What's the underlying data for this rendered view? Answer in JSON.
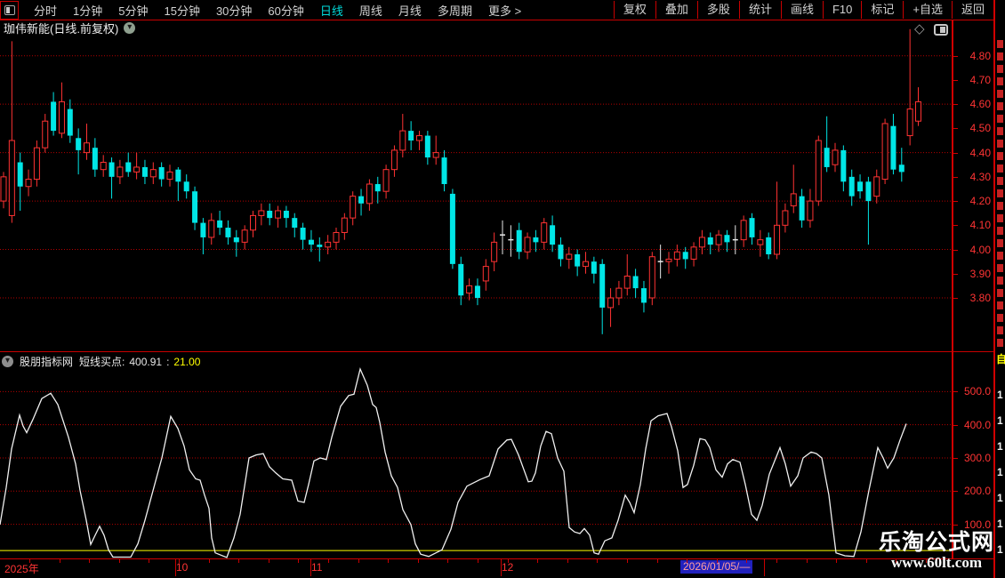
{
  "colors": {
    "up": "#ff3232",
    "down": "#00e6e6",
    "doji": "#e8e8e8",
    "grid": "#b40000",
    "axis_text": "#ff3434",
    "yellow_line": "#ffff00",
    "active_tab": "#00dcdc",
    "highlight_bg": "#2121bd"
  },
  "toolbar": {
    "left_items": [
      {
        "label": "分时",
        "active": false
      },
      {
        "label": "1分钟",
        "active": false
      },
      {
        "label": "5分钟",
        "active": false
      },
      {
        "label": "15分钟",
        "active": false
      },
      {
        "label": "30分钟",
        "active": false
      },
      {
        "label": "60分钟",
        "active": false
      },
      {
        "label": "日线",
        "active": true
      },
      {
        "label": "周线",
        "active": false
      },
      {
        "label": "月线",
        "active": false
      },
      {
        "label": "多周期",
        "active": false
      },
      {
        "label": "更多 >",
        "active": false
      }
    ],
    "right_items": [
      "复权",
      "叠加",
      "多股",
      "统计",
      "画线",
      "F10",
      "标记",
      "+自选",
      "返回"
    ]
  },
  "chart_header": {
    "title": "珈伟新能(日线.前复权)"
  },
  "main_chart": {
    "y_labels": [
      "4.80",
      "4.70",
      "4.60",
      "4.50",
      "4.40",
      "4.30",
      "4.20",
      "4.10",
      "4.00",
      "3.90",
      "3.80"
    ],
    "grid_prices": [
      4.8,
      4.6,
      4.4,
      4.2,
      4.0,
      3.8
    ]
  },
  "indicator": {
    "source": "股朋指标网",
    "name": "短线买点:",
    "value": "400.91",
    "sep": ":",
    "value2": "21.00",
    "y_labels": [
      "500.0",
      "400.0",
      "300.0",
      "200.0",
      "100.0"
    ]
  },
  "date_axis": {
    "labels": [
      {
        "text": "2025年",
        "x": 5
      },
      {
        "text": "10",
        "x": 198
      },
      {
        "text": "11",
        "x": 350
      },
      {
        "text": "12",
        "x": 564
      }
    ],
    "selected": {
      "text": "2026/01/05/—",
      "x": 765
    },
    "tall_ticks": [
      197,
      349,
      563,
      859
    ]
  },
  "watermark": {
    "line1": "乐淘公式网",
    "line2": "www.60lt.com"
  },
  "right_edge_panel": {
    "tab": "自",
    "numbers": [
      "1",
      "1",
      "1",
      "1",
      "1",
      "1",
      "1"
    ]
  },
  "chart_data": [
    {
      "type": "candlestick",
      "title": "珈伟新能 日线 前复权",
      "ylim": [
        3.6,
        4.95
      ],
      "y_ticks": [
        3.8,
        3.9,
        4.0,
        4.1,
        4.2,
        4.3,
        4.4,
        4.5,
        4.6,
        4.7,
        4.8
      ],
      "note": "o,h,l,c per day; close==open rendered as white doji cross",
      "candles": [
        [
          4.2,
          4.32,
          4.17,
          4.3
        ],
        [
          4.14,
          4.86,
          4.11,
          4.45
        ],
        [
          4.36,
          4.4,
          4.16,
          4.26
        ],
        [
          4.26,
          4.33,
          4.22,
          4.29
        ],
        [
          4.29,
          4.45,
          4.26,
          4.42
        ],
        [
          4.42,
          4.56,
          4.4,
          4.53
        ],
        [
          4.61,
          4.65,
          4.47,
          4.49
        ],
        [
          4.48,
          4.69,
          4.46,
          4.61
        ],
        [
          4.58,
          4.62,
          4.44,
          4.47
        ],
        [
          4.46,
          4.5,
          4.31,
          4.41
        ],
        [
          4.4,
          4.52,
          4.37,
          4.44
        ],
        [
          4.42,
          4.46,
          4.3,
          4.33
        ],
        [
          4.33,
          4.39,
          4.3,
          4.36
        ],
        [
          4.36,
          4.38,
          4.21,
          4.3
        ],
        [
          4.3,
          4.37,
          4.27,
          4.34
        ],
        [
          4.36,
          4.4,
          4.3,
          4.32
        ],
        [
          4.32,
          4.4,
          4.29,
          4.34
        ],
        [
          4.34,
          4.37,
          4.27,
          4.3
        ],
        [
          4.3,
          4.36,
          4.27,
          4.33
        ],
        [
          4.34,
          4.36,
          4.26,
          4.29
        ],
        [
          4.29,
          4.35,
          4.26,
          4.32
        ],
        [
          4.33,
          4.34,
          4.2,
          4.28
        ],
        [
          4.28,
          4.31,
          4.21,
          4.24
        ],
        [
          4.24,
          4.26,
          4.08,
          4.11
        ],
        [
          4.11,
          4.13,
          3.98,
          4.05
        ],
        [
          4.05,
          4.15,
          4.02,
          4.12
        ],
        [
          4.12,
          4.16,
          4.06,
          4.09
        ],
        [
          4.09,
          4.12,
          4.02,
          4.05
        ],
        [
          4.05,
          4.08,
          3.97,
          4.03
        ],
        [
          4.03,
          4.1,
          4.0,
          4.08
        ],
        [
          4.08,
          4.16,
          4.05,
          4.14
        ],
        [
          4.14,
          4.19,
          4.1,
          4.16
        ],
        [
          4.16,
          4.19,
          4.1,
          4.13
        ],
        [
          4.13,
          4.18,
          4.09,
          4.16
        ],
        [
          4.16,
          4.18,
          4.09,
          4.13
        ],
        [
          4.13,
          4.15,
          4.05,
          4.09
        ],
        [
          4.09,
          4.11,
          4.0,
          4.04
        ],
        [
          4.04,
          4.08,
          3.99,
          4.02
        ],
        [
          4.02,
          4.05,
          3.95,
          4.01
        ],
        [
          4.01,
          4.06,
          3.98,
          4.03
        ],
        [
          4.03,
          4.09,
          4.0,
          4.07
        ],
        [
          4.07,
          4.15,
          4.04,
          4.13
        ],
        [
          4.13,
          4.24,
          4.1,
          4.22
        ],
        [
          4.22,
          4.25,
          4.14,
          4.19
        ],
        [
          4.19,
          4.29,
          4.16,
          4.27
        ],
        [
          4.27,
          4.3,
          4.19,
          4.24
        ],
        [
          4.24,
          4.35,
          4.21,
          4.33
        ],
        [
          4.33,
          4.43,
          4.3,
          4.41
        ],
        [
          4.41,
          4.56,
          4.38,
          4.49
        ],
        [
          4.49,
          4.53,
          4.41,
          4.45
        ],
        [
          4.45,
          4.49,
          4.41,
          4.47
        ],
        [
          4.47,
          4.49,
          4.35,
          4.38
        ],
        [
          4.38,
          4.47,
          4.35,
          4.4
        ],
        [
          4.38,
          4.41,
          4.24,
          4.27
        ],
        [
          4.23,
          4.25,
          3.92,
          3.94
        ],
        [
          3.94,
          3.97,
          3.77,
          3.81
        ],
        [
          3.82,
          3.88,
          3.79,
          3.85
        ],
        [
          3.85,
          3.88,
          3.77,
          3.8
        ],
        [
          3.87,
          3.96,
          3.83,
          3.93
        ],
        [
          3.95,
          4.07,
          3.91,
          4.03
        ],
        [
          4.06,
          4.12,
          3.98,
          4.06
        ],
        [
          4.04,
          4.1,
          3.97,
          4.04
        ],
        [
          4.08,
          4.11,
          3.96,
          3.99
        ],
        [
          3.99,
          4.07,
          3.96,
          4.05
        ],
        [
          4.05,
          4.08,
          3.99,
          4.03
        ],
        [
          4.03,
          4.13,
          4.0,
          4.11
        ],
        [
          4.1,
          4.14,
          3.99,
          4.02
        ],
        [
          4.02,
          4.05,
          3.93,
          3.96
        ],
        [
          3.96,
          4.01,
          3.92,
          3.98
        ],
        [
          3.98,
          4.0,
          3.89,
          3.93
        ],
        [
          3.93,
          3.99,
          3.9,
          3.95
        ],
        [
          3.95,
          3.97,
          3.86,
          3.9
        ],
        [
          3.94,
          3.96,
          3.65,
          3.76
        ],
        [
          3.76,
          3.84,
          3.68,
          3.8
        ],
        [
          3.8,
          3.87,
          3.77,
          3.84
        ],
        [
          3.84,
          3.98,
          3.81,
          3.89
        ],
        [
          3.89,
          3.92,
          3.8,
          3.84
        ],
        [
          3.84,
          3.87,
          3.74,
          3.78
        ],
        [
          3.8,
          3.99,
          3.77,
          3.97
        ],
        [
          3.95,
          4.02,
          3.88,
          3.95
        ],
        [
          3.95,
          3.99,
          3.9,
          3.96
        ],
        [
          3.96,
          4.02,
          3.93,
          3.99
        ],
        [
          3.99,
          4.01,
          3.92,
          3.96
        ],
        [
          3.96,
          4.03,
          3.93,
          4.01
        ],
        [
          4.01,
          4.08,
          3.98,
          4.05
        ],
        [
          4.05,
          4.07,
          3.98,
          4.02
        ],
        [
          4.02,
          4.08,
          3.99,
          4.06
        ],
        [
          4.06,
          4.08,
          3.99,
          4.03
        ],
        [
          4.04,
          4.1,
          3.98,
          4.04
        ],
        [
          4.04,
          4.14,
          4.01,
          4.12
        ],
        [
          4.13,
          4.15,
          4.02,
          4.05
        ],
        [
          4.02,
          4.08,
          3.97,
          4.04
        ],
        [
          4.05,
          4.07,
          3.96,
          3.98
        ],
        [
          3.98,
          4.28,
          3.96,
          4.1
        ],
        [
          4.1,
          4.19,
          4.07,
          4.16
        ],
        [
          4.18,
          4.35,
          4.15,
          4.23
        ],
        [
          4.22,
          4.25,
          4.09,
          4.12
        ],
        [
          4.12,
          4.25,
          4.09,
          4.2
        ],
        [
          4.2,
          4.47,
          4.18,
          4.45
        ],
        [
          4.42,
          4.55,
          4.32,
          4.34
        ],
        [
          4.35,
          4.44,
          4.32,
          4.41
        ],
        [
          4.41,
          4.43,
          4.24,
          4.28
        ],
        [
          4.3,
          4.33,
          4.18,
          4.22
        ],
        [
          4.28,
          4.31,
          4.21,
          4.24
        ],
        [
          4.28,
          4.3,
          4.02,
          4.2
        ],
        [
          4.22,
          4.33,
          4.19,
          4.3
        ],
        [
          4.29,
          4.54,
          4.27,
          4.52
        ],
        [
          4.51,
          4.56,
          4.31,
          4.33
        ],
        [
          4.35,
          4.42,
          4.28,
          4.32
        ],
        [
          4.47,
          4.91,
          4.43,
          4.58
        ],
        [
          4.53,
          4.67,
          4.51,
          4.61
        ]
      ]
    },
    {
      "type": "line",
      "name": "短线买点",
      "current_value": 400.91,
      "level_line_value": 21.0,
      "ylim": [
        0,
        580
      ],
      "y_ticks": [
        100,
        200,
        300,
        400,
        500
      ],
      "x_unit": "px",
      "points": [
        [
          0,
          99
        ],
        [
          7,
          211
        ],
        [
          13,
          327
        ],
        [
          22,
          429
        ],
        [
          26,
          396
        ],
        [
          30,
          376
        ],
        [
          37,
          416
        ],
        [
          47,
          479
        ],
        [
          57,
          495
        ],
        [
          65,
          461
        ],
        [
          77,
          362
        ],
        [
          85,
          282
        ],
        [
          90,
          202
        ],
        [
          97,
          112
        ],
        [
          102,
          39
        ],
        [
          107,
          67
        ],
        [
          112,
          94
        ],
        [
          117,
          67
        ],
        [
          122,
          23
        ],
        [
          127,
          1
        ],
        [
          147,
          1
        ],
        [
          155,
          41
        ],
        [
          163,
          112
        ],
        [
          173,
          211
        ],
        [
          182,
          300
        ],
        [
          192,
          425
        ],
        [
          200,
          389
        ],
        [
          207,
          336
        ],
        [
          213,
          264
        ],
        [
          220,
          237
        ],
        [
          225,
          233
        ],
        [
          230,
          188
        ],
        [
          235,
          148
        ],
        [
          238,
          59
        ],
        [
          242,
          14
        ],
        [
          255,
          0
        ],
        [
          263,
          59
        ],
        [
          270,
          130
        ],
        [
          280,
          300
        ],
        [
          288,
          309
        ],
        [
          296,
          313
        ],
        [
          303,
          273
        ],
        [
          310,
          255
        ],
        [
          318,
          237
        ],
        [
          328,
          233
        ],
        [
          335,
          170
        ],
        [
          342,
          166
        ],
        [
          347,
          220
        ],
        [
          353,
          291
        ],
        [
          360,
          300
        ],
        [
          367,
          295
        ],
        [
          373,
          362
        ],
        [
          383,
          456
        ],
        [
          392,
          488
        ],
        [
          398,
          492
        ],
        [
          405,
          568
        ],
        [
          413,
          519
        ],
        [
          419,
          461
        ],
        [
          423,
          452
        ],
        [
          427,
          407
        ],
        [
          433,
          318
        ],
        [
          440,
          246
        ],
        [
          447,
          211
        ],
        [
          453,
          144
        ],
        [
          462,
          99
        ],
        [
          467,
          41
        ],
        [
          473,
          10
        ],
        [
          482,
          3
        ],
        [
          497,
          23
        ],
        [
          507,
          85
        ],
        [
          515,
          166
        ],
        [
          525,
          215
        ],
        [
          540,
          235
        ],
        [
          550,
          246
        ],
        [
          560,
          327
        ],
        [
          570,
          354
        ],
        [
          575,
          356
        ],
        [
          583,
          309
        ],
        [
          594,
          228
        ],
        [
          598,
          230
        ],
        [
          602,
          255
        ],
        [
          608,
          336
        ],
        [
          614,
          380
        ],
        [
          620,
          373
        ],
        [
          627,
          300
        ],
        [
          634,
          260
        ],
        [
          640,
          90
        ],
        [
          646,
          77
        ],
        [
          652,
          72
        ],
        [
          657,
          87
        ],
        [
          663,
          67
        ],
        [
          668,
          14
        ],
        [
          673,
          10
        ],
        [
          680,
          50
        ],
        [
          688,
          59
        ],
        [
          695,
          112
        ],
        [
          703,
          188
        ],
        [
          708,
          166
        ],
        [
          713,
          135
        ],
        [
          720,
          220
        ],
        [
          726,
          327
        ],
        [
          732,
          412
        ],
        [
          740,
          427
        ],
        [
          750,
          434
        ],
        [
          755,
          394
        ],
        [
          762,
          322
        ],
        [
          768,
          211
        ],
        [
          773,
          220
        ],
        [
          780,
          278
        ],
        [
          787,
          358
        ],
        [
          793,
          354
        ],
        [
          798,
          331
        ],
        [
          805,
          264
        ],
        [
          812,
          242
        ],
        [
          818,
          282
        ],
        [
          824,
          295
        ],
        [
          832,
          287
        ],
        [
          838,
          220
        ],
        [
          845,
          130
        ],
        [
          851,
          112
        ],
        [
          857,
          157
        ],
        [
          865,
          251
        ],
        [
          877,
          331
        ],
        [
          883,
          282
        ],
        [
          889,
          215
        ],
        [
          897,
          246
        ],
        [
          903,
          300
        ],
        [
          912,
          318
        ],
        [
          918,
          313
        ],
        [
          924,
          300
        ],
        [
          932,
          188
        ],
        [
          935,
          121
        ],
        [
          940,
          14
        ],
        [
          950,
          5
        ],
        [
          960,
          3
        ],
        [
          968,
          77
        ],
        [
          977,
          202
        ],
        [
          987,
          331
        ],
        [
          993,
          300
        ],
        [
          998,
          269
        ],
        [
          1005,
          300
        ],
        [
          1012,
          354
        ],
        [
          1019,
          403
        ]
      ]
    }
  ]
}
